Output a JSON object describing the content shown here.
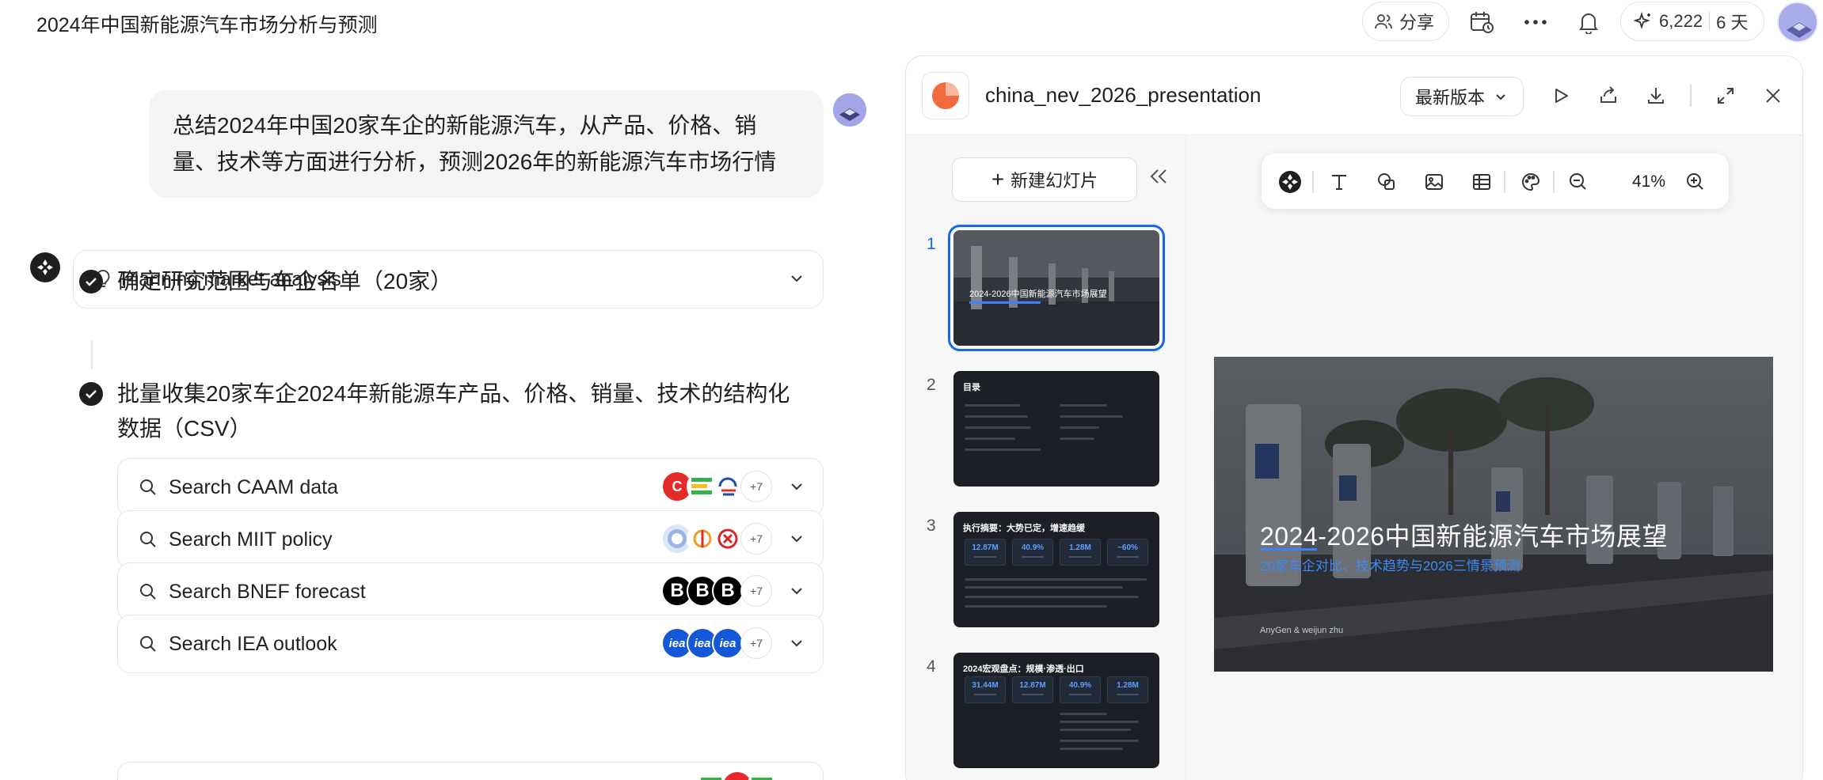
{
  "header": {
    "doc_title": "2024年中国新能源汽车市场分析与预测",
    "share_label": "分享",
    "credits": "6,222",
    "days": "6 天"
  },
  "chat": {
    "user_message": "总结2024年中国20家车企的新能源汽车，从产品、价格、销量、技术等方面进行分析，预测2026年的新能源汽车市场行情",
    "plan_title": "Planning market analysis",
    "steps": [
      "确定研究范围与车企名单（20家）",
      "批量收集20家车企2024年新能源车产品、价格、销量、技术的结构化数据（CSV）"
    ],
    "searches": [
      {
        "label": "Search CAAM data",
        "more": "+7"
      },
      {
        "label": "Search MIIT policy",
        "more": "+7"
      },
      {
        "label": "Search BNEF forecast",
        "more": "+7"
      },
      {
        "label": "Search IEA outlook",
        "more": "+7"
      }
    ]
  },
  "panel": {
    "file_name": "china_nev_2026_presentation",
    "version_label": "最新版本",
    "new_slide_label": "新建幻灯片",
    "zoom": "41%",
    "thumbnails": [
      {
        "num": "1",
        "title": "2024-2026中国新能源汽车市场展望"
      },
      {
        "num": "2",
        "title": "目录"
      },
      {
        "num": "3",
        "title": "执行摘要：大势已定，增速趋缓",
        "stats": [
          "12.87M",
          "40.9%",
          "1.28M",
          "~60%"
        ]
      },
      {
        "num": "4",
        "title": "2024宏观盘点：规模·渗透·出口",
        "stats": [
          "31.44M",
          "12.87M",
          "40.9%",
          "1.28M"
        ]
      }
    ],
    "slide": {
      "title": "2024-2026中国新能源汽车市场展望",
      "subtitle": "20家车企对比、技术趋势与2026三情景预测",
      "author": "AnyGen & weijun zhu"
    }
  },
  "colors": {
    "accent": "#1a66e8",
    "slide_accent": "#3b82f6",
    "ppt_orange": "#f26a3d"
  }
}
